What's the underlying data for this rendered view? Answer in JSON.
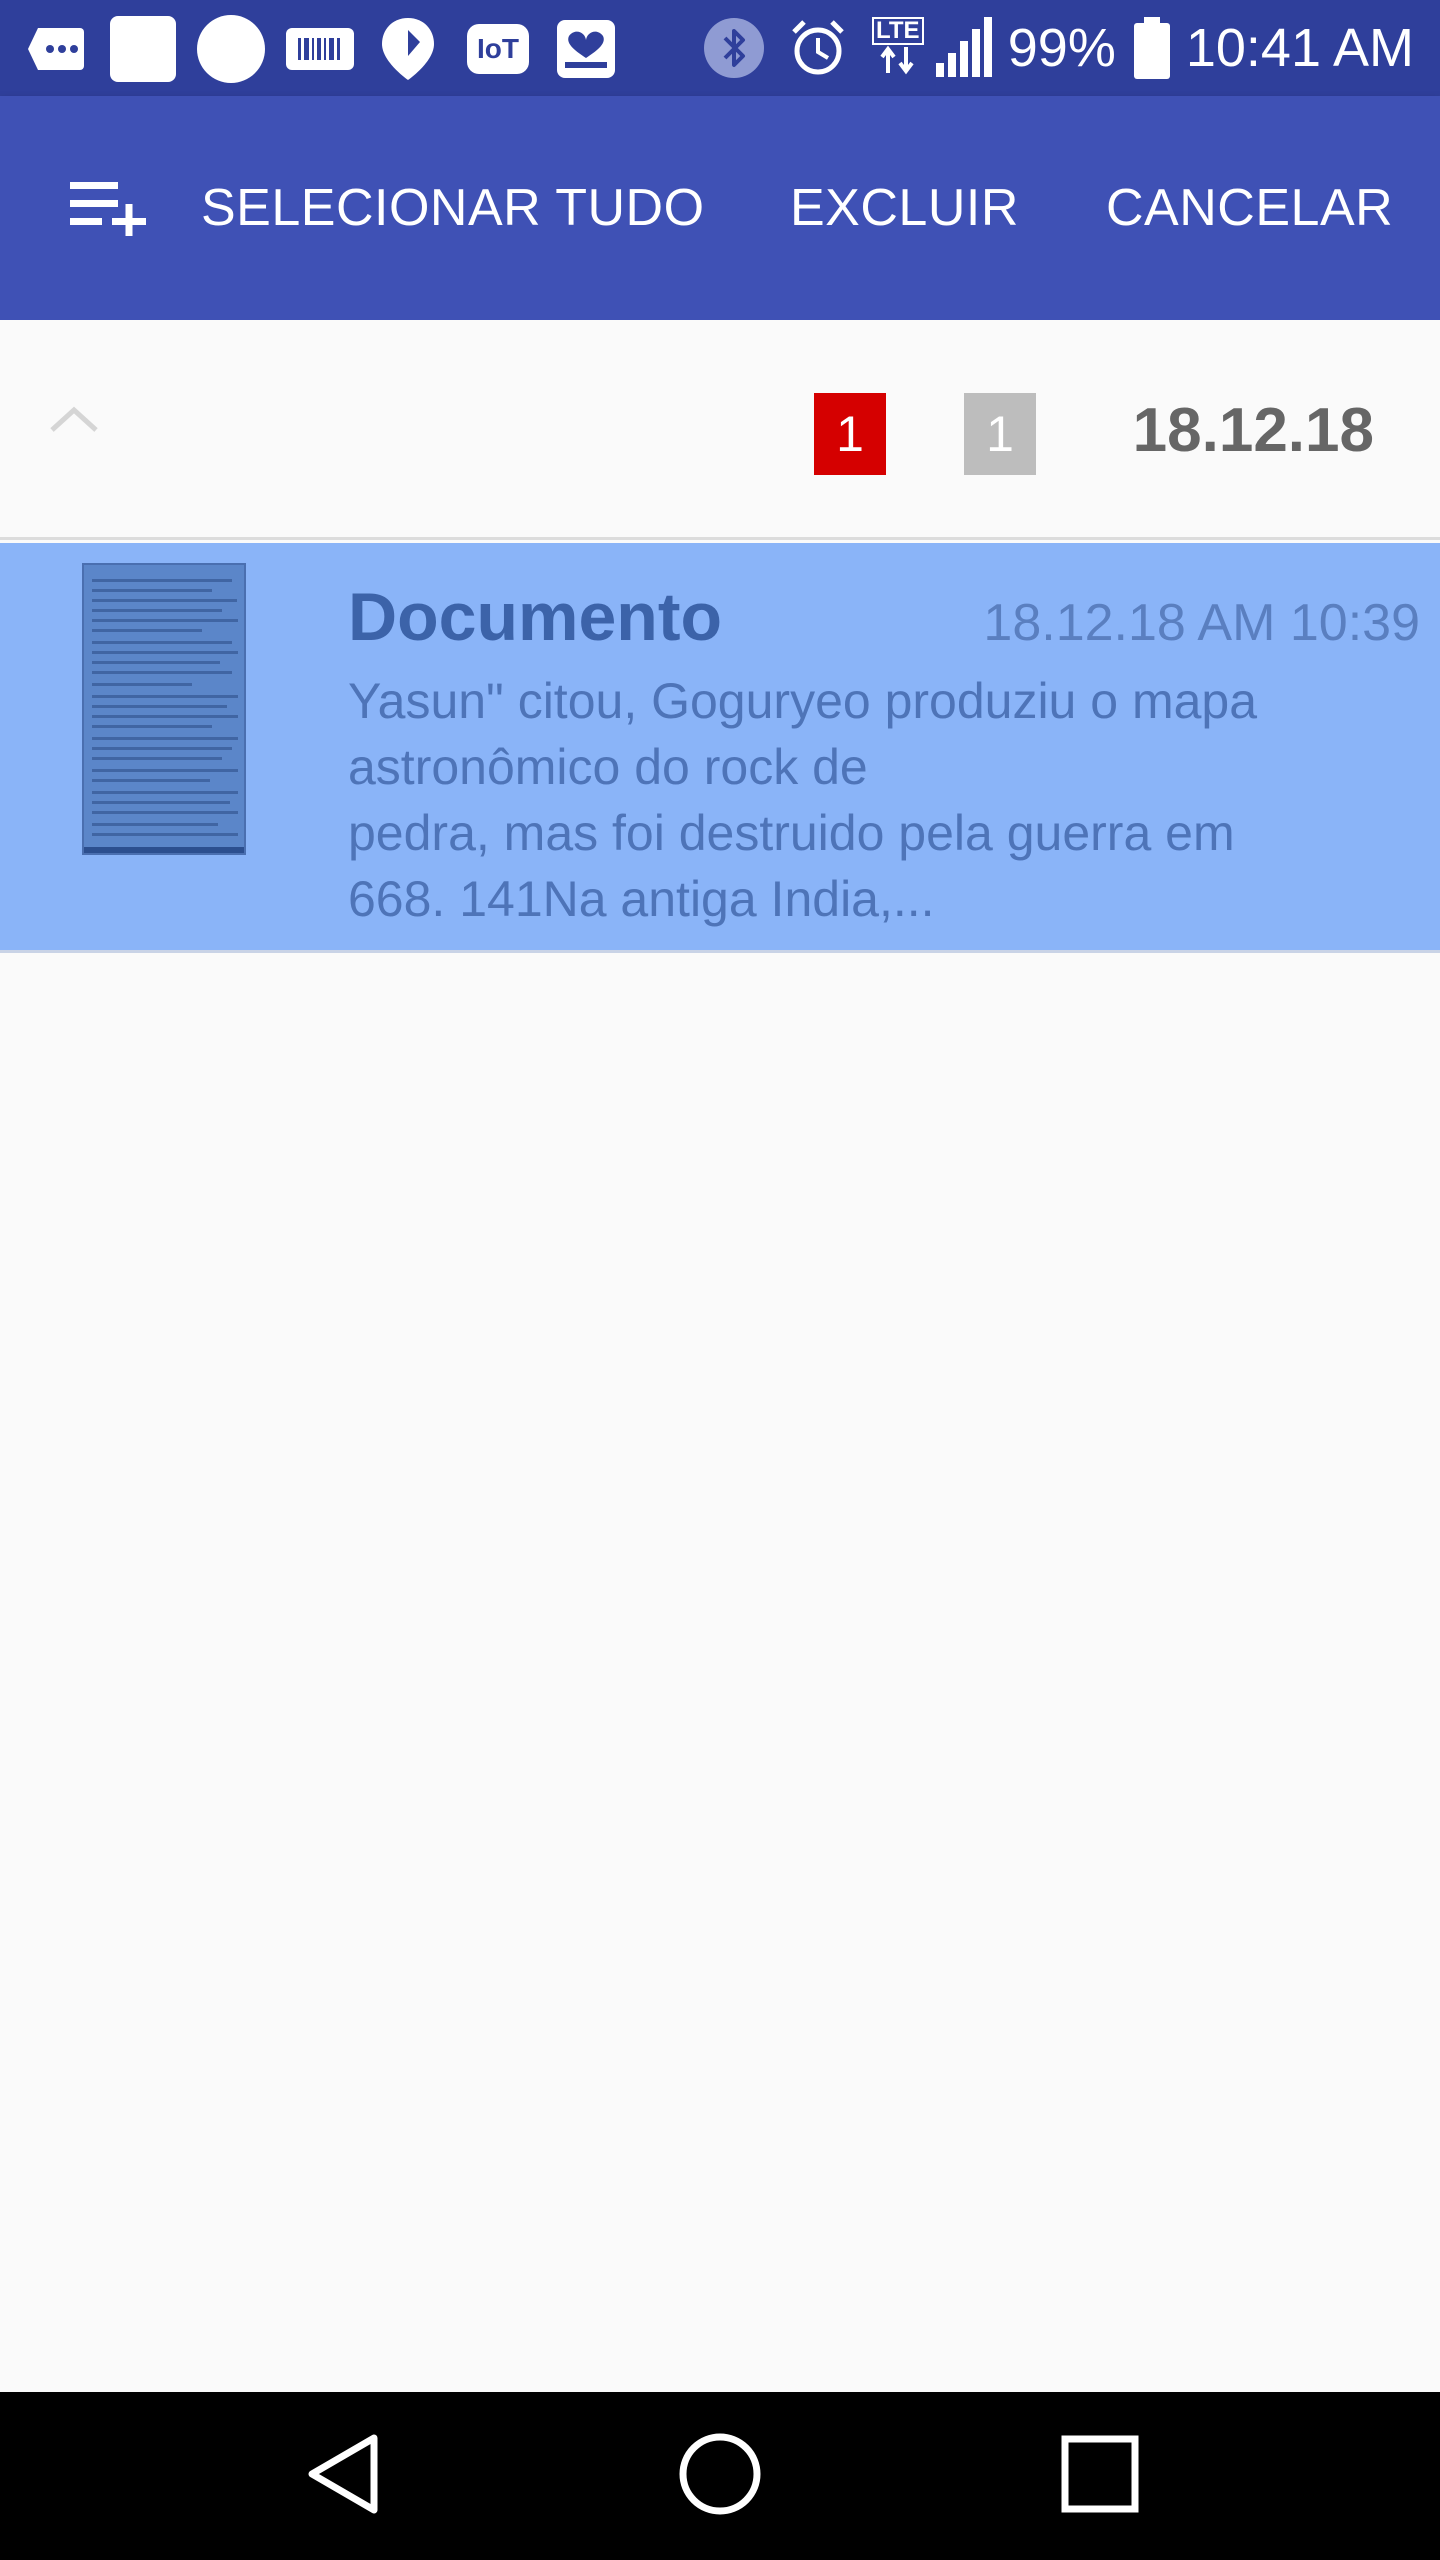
{
  "status_bar": {
    "battery": "99%",
    "time": "10:41 AM",
    "network": "LTE",
    "notification_icons": [
      "chat-icon",
      "square-icon",
      "circle-icon",
      "barcode-icon",
      "map-pin-icon",
      "iot-icon",
      "gallery-icon"
    ],
    "system_icons": [
      "bluetooth-icon",
      "alarm-icon",
      "lte-icon",
      "signal-icon",
      "battery-icon"
    ]
  },
  "app_bar": {
    "select_all_icon": "playlist-add-icon",
    "select_all_label": "SELECIONAR TUDO",
    "delete_label": "EXCLUIR",
    "cancel_label": "CANCELAR",
    "background": "#3f51b5"
  },
  "group": {
    "date": "18.12.18",
    "badge_selected": "1",
    "badge_total": "1",
    "badge_selected_color": "#d50000",
    "badge_total_color": "#bdbdbd"
  },
  "documents": [
    {
      "title": "Documento",
      "timestamp": "18.12.18 AM 10:39",
      "preview_lines": [
        "Yasun\" citou, Goguryeo produziu o mapa",
        "astronômico do rock de",
        "pedra, mas foi destruido pela guerra em",
        "668. 141Na antiga India,..."
      ],
      "selected": true
    }
  ],
  "nav": {
    "back": "back-icon",
    "home": "home-icon",
    "recents": "recents-icon"
  }
}
